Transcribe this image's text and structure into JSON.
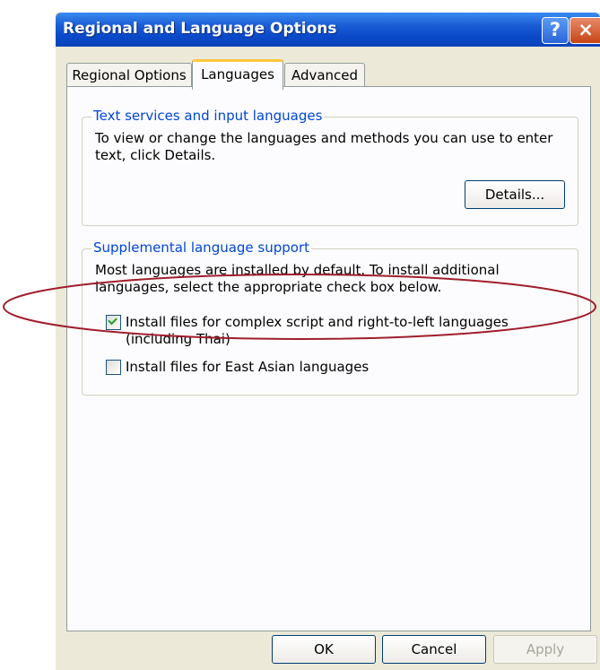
{
  "window": {
    "title": "Regional and Language Options",
    "help_label": "?",
    "close_label": "×"
  },
  "tabs": [
    {
      "label": "Regional Options"
    },
    {
      "label": "Languages"
    },
    {
      "label": "Advanced"
    }
  ],
  "text_services": {
    "legend": "Text services and input languages",
    "description": "To view or change the languages and methods you can use to enter text, click Details.",
    "details_label": "Details..."
  },
  "supplemental": {
    "legend": "Supplemental language support",
    "description": "Most languages are installed by default. To install additional languages, select the appropriate check box below.",
    "complex_script_label": "Install files for complex script and right-to-left languages (including Thai)",
    "complex_script_checked": true,
    "east_asian_label": "Install files for East Asian languages",
    "east_asian_checked": false
  },
  "footer": {
    "ok_label": "OK",
    "cancel_label": "Cancel",
    "apply_label": "Apply"
  },
  "colors": {
    "annotation": "#a01e2c",
    "titlebar": "#0a49c9",
    "legend": "#0046d5"
  }
}
